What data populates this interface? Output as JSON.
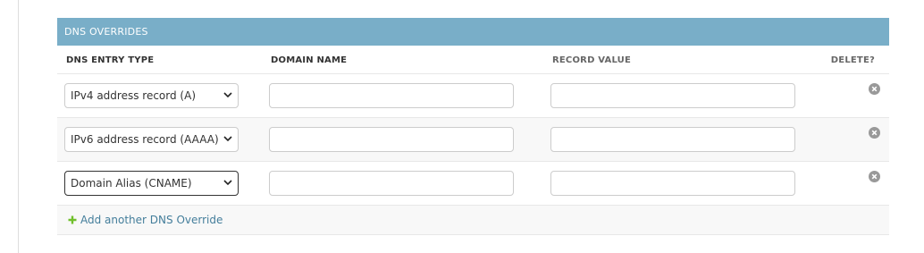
{
  "module": {
    "title": "DNS OVERRIDES"
  },
  "columns": {
    "type": "DNS ENTRY TYPE",
    "domain": "DOMAIN NAME",
    "value": "RECORD VALUE",
    "delete": "DELETE?"
  },
  "rows": [
    {
      "type": "IPv4 address record (A)",
      "domain": "",
      "value": ""
    },
    {
      "type": "IPv6 address record (AAAA)",
      "domain": "",
      "value": ""
    },
    {
      "type": "Domain Alias (CNAME)",
      "domain": "",
      "value": ""
    }
  ],
  "add_link": {
    "label": "Add another DNS Override"
  },
  "colors": {
    "header_bg": "#79aec8",
    "link": "#447e9b",
    "add_icon": "#70bf2b",
    "delete_icon": "#999999"
  },
  "icons": {
    "select_arrow": "chevron-down-icon",
    "delete": "delete-icon",
    "add": "plus-icon"
  }
}
